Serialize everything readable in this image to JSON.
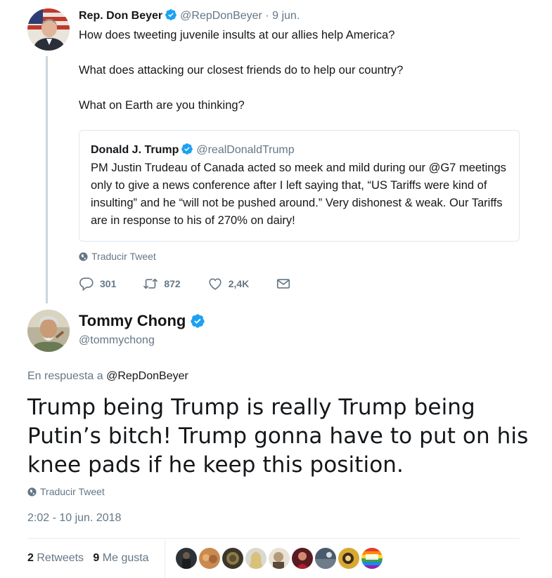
{
  "parent_tweet": {
    "author_name": "Rep. Don Beyer",
    "author_handle": "@RepDonBeyer",
    "date": "· 9 jun.",
    "lines": [
      "How does tweeting juvenile insults at our allies help America?",
      "What does attacking our closest friends do to help our country?",
      "What on Earth are you thinking?"
    ],
    "quoted": {
      "author_name": "Donald J. Trump",
      "author_handle": "@realDonaldTrump",
      "text": "PM Justin Trudeau of Canada acted so meek and mild during our @G7 meetings only to give a news conference after I left saying that, “US Tariffs were kind of insulting” and he “will not be pushed around.” Very dishonest & weak. Our Tariffs are in response to his of 270% on dairy!"
    },
    "translate_label": "Traducir Tweet",
    "replies": "301",
    "retweets": "872",
    "likes": "2,4K"
  },
  "main_tweet": {
    "author_name": "Tommy Chong",
    "author_handle": "@tommychong",
    "reply_prefix": "En respuesta a",
    "reply_mention": "@RepDonBeyer",
    "text": "Trump being Trump is really Trump being Putin’s bitch! Trump gonna have to put on his knee pads if he keep this position.",
    "translate_label": "Traducir Tweet",
    "timestamp": "2:02 - 10 jun. 2018",
    "retweet_count": "2",
    "retweet_label": "Retweets",
    "like_count": "9",
    "like_label": "Me gusta"
  },
  "colors": {
    "verified": "#1da1f2",
    "secondary_text": "#657786",
    "border": "#e1e8ed"
  },
  "icons": {
    "verified": "verified-badge-icon",
    "globe": "globe-icon",
    "reply": "reply-icon",
    "retweet": "retweet-icon",
    "like": "heart-icon",
    "message": "envelope-icon"
  }
}
